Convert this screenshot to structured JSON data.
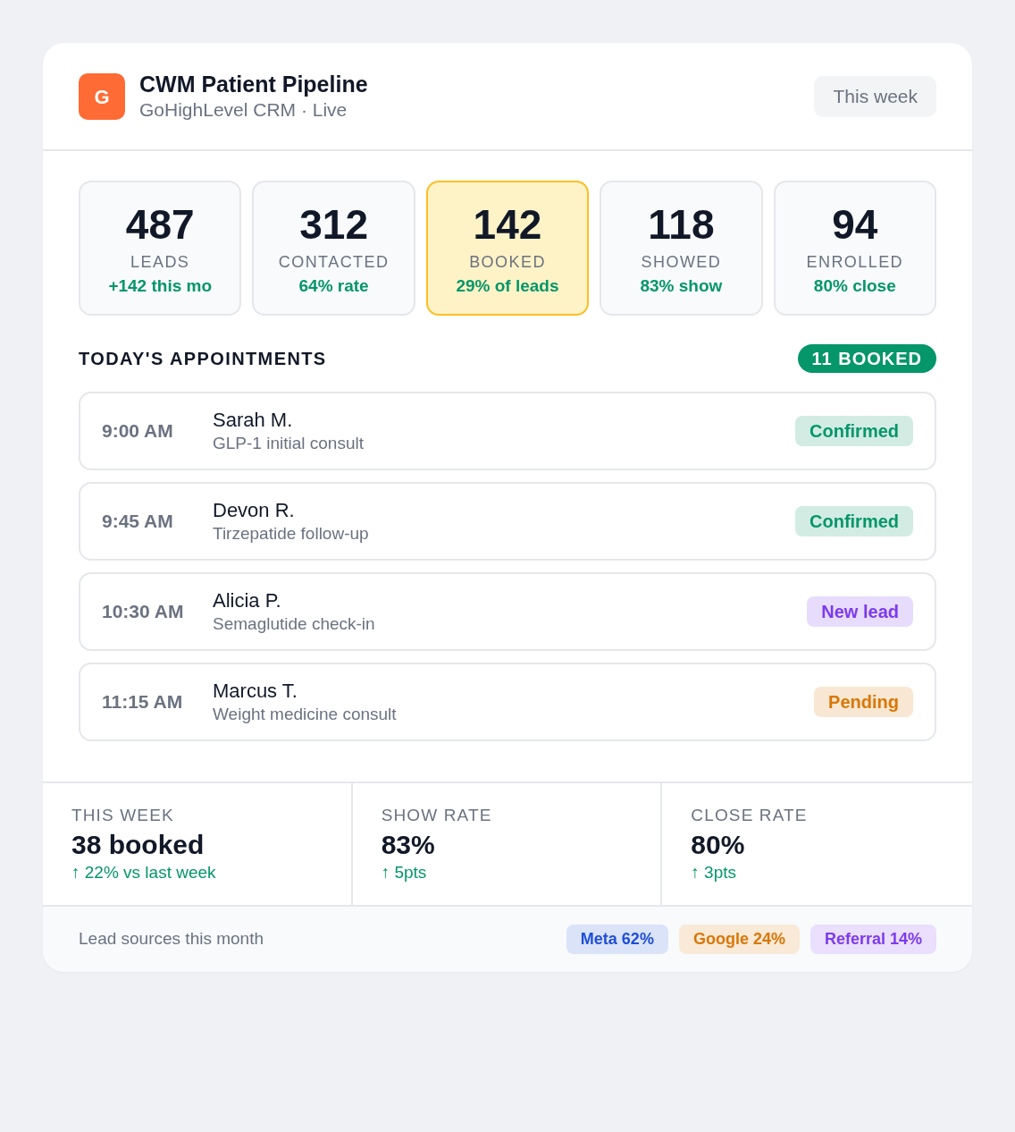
{
  "header": {
    "logo": "G",
    "title": "CWM Patient Pipeline",
    "subtitle": "GoHighLevel CRM · Live",
    "period_button": "This week"
  },
  "stats": [
    {
      "value": "487",
      "label": "LEADS",
      "note": "+142 this mo",
      "highlighted": false
    },
    {
      "value": "312",
      "label": "CONTACTED",
      "note": "64% rate",
      "highlighted": false
    },
    {
      "value": "142",
      "label": "BOOKED",
      "note": "29% of leads",
      "highlighted": true
    },
    {
      "value": "118",
      "label": "SHOWED",
      "note": "83% show",
      "highlighted": false
    },
    {
      "value": "94",
      "label": "ENROLLED",
      "note": "80% close",
      "highlighted": false
    }
  ],
  "appointments": {
    "title": "TODAY'S APPOINTMENTS",
    "badge": "11 BOOKED",
    "rows": [
      {
        "time": "9:00 AM",
        "name": "Sarah M.",
        "service": "GLP-1 initial consult",
        "status": {
          "label": "Confirmed",
          "color": "#059669"
        }
      },
      {
        "time": "9:45 AM",
        "name": "Devon R.",
        "service": "Tirzepatide follow-up",
        "status": {
          "label": "Confirmed",
          "color": "#059669"
        }
      },
      {
        "time": "10:30 AM",
        "name": "Alicia P.",
        "service": "Semaglutide check-in",
        "status": {
          "label": "New lead",
          "color": "#7c3aed"
        }
      },
      {
        "time": "11:15 AM",
        "name": "Marcus T.",
        "service": "Weight medicine consult",
        "status": {
          "label": "Pending",
          "color": "#d97706"
        }
      }
    ]
  },
  "summary": [
    {
      "label": "THIS WEEK",
      "value": "38 booked",
      "delta": "↑ 22% vs last week"
    },
    {
      "label": "SHOW RATE",
      "value": "83%",
      "delta": "↑ 5pts"
    },
    {
      "label": "CLOSE RATE",
      "value": "80%",
      "delta": "↑ 3pts"
    }
  ],
  "footer": {
    "label": "Lead sources this month",
    "sources": [
      {
        "label": "Meta 62%",
        "color": "#1d4ed8"
      },
      {
        "label": "Google 24%",
        "color": "#d97706"
      },
      {
        "label": "Referral 14%",
        "color": "#7c3aed"
      }
    ]
  }
}
